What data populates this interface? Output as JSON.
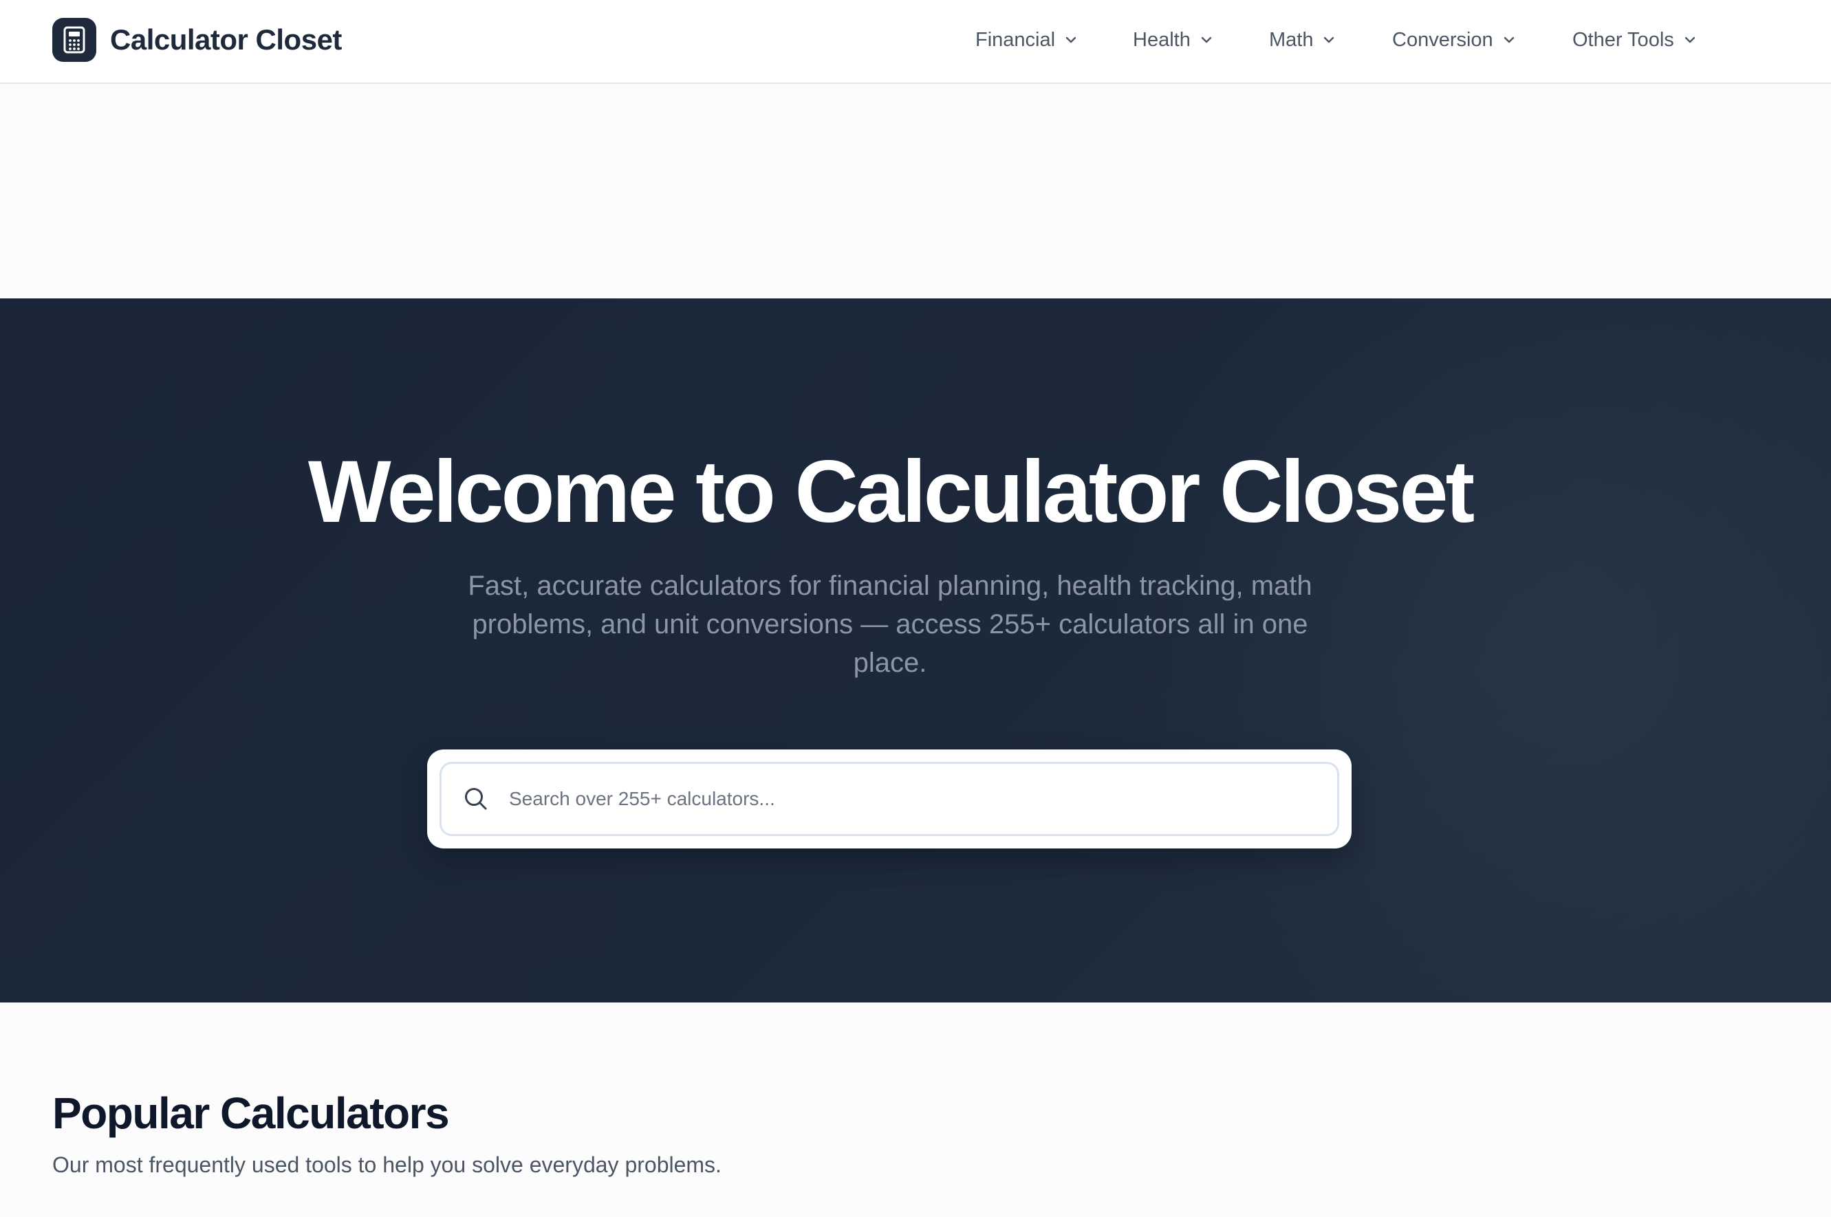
{
  "header": {
    "brand_name": "Calculator Closet",
    "brand_icon": "calculator-icon",
    "nav": [
      {
        "label": "Financial",
        "icon": "chevron-down-icon"
      },
      {
        "label": "Health",
        "icon": "chevron-down-icon"
      },
      {
        "label": "Math",
        "icon": "chevron-down-icon"
      },
      {
        "label": "Conversion",
        "icon": "chevron-down-icon"
      },
      {
        "label": "Other Tools",
        "icon": "chevron-down-icon"
      }
    ]
  },
  "hero": {
    "title": "Welcome to Calculator Closet",
    "subtitle": "Fast, accurate calculators for financial planning, health tracking, math problems, and unit conversions — access 255+ calculators all in one place.",
    "search": {
      "placeholder": "Search over 255+ calculators...",
      "value": "",
      "icon": "search-icon"
    }
  },
  "popular": {
    "title": "Popular Calculators",
    "subtitle": "Our most frequently used tools to help you solve everyday problems."
  },
  "colors": {
    "brand_dark": "#1e293b",
    "hero_bg": "#1c293b",
    "page_bg": "#fcfcfc",
    "nav_text": "#4b5563",
    "hero_sub_text": "#8c97a6"
  }
}
